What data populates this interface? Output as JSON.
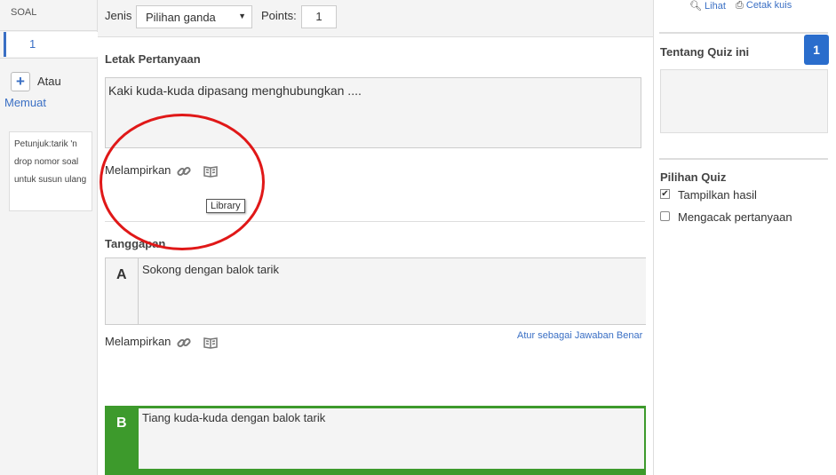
{
  "sidebar": {
    "header": "SOAL",
    "question_number": "1",
    "add_icon": "+",
    "or_label": "Atau",
    "load_link": "Memuat",
    "hint": "Petunjuk:tarik 'n drop nomor soal untuk susun ulang"
  },
  "toolbar": {
    "type_label": "Jenis",
    "type_value": "Pilihan ganda",
    "points_label": "Points:",
    "points_value": "1"
  },
  "question": {
    "section_label": "Letak Pertanyaan",
    "text": "Kaki kuda-kuda dipasang menghubungkan ....",
    "attach_label": "Melampirkan",
    "tooltip": "Library"
  },
  "responses": {
    "section_label": "Tanggapan",
    "answers": [
      {
        "letter": "A",
        "text": "Sokong dengan balok tarik",
        "attach_label": "Melampirkan",
        "set_correct": "Atur sebagai Jawaban Benar"
      },
      {
        "letter": "B",
        "text": "Tiang kuda-kuda dengan balok tarik"
      }
    ]
  },
  "right_panel": {
    "view_link": "Lihat",
    "print_link": "Cetak kuis",
    "about_title": "Tentang Quiz ini",
    "badge": "1",
    "options_title": "Pilihan Quiz",
    "options": [
      {
        "label": "Tampilkan hasil",
        "checked": true
      },
      {
        "label": "Mengacak pertanyaan",
        "checked": false
      }
    ]
  },
  "colors": {
    "accent_blue": "#3a6fc4",
    "correct_green": "#3d9a2c",
    "annotation_red": "#e01818"
  }
}
